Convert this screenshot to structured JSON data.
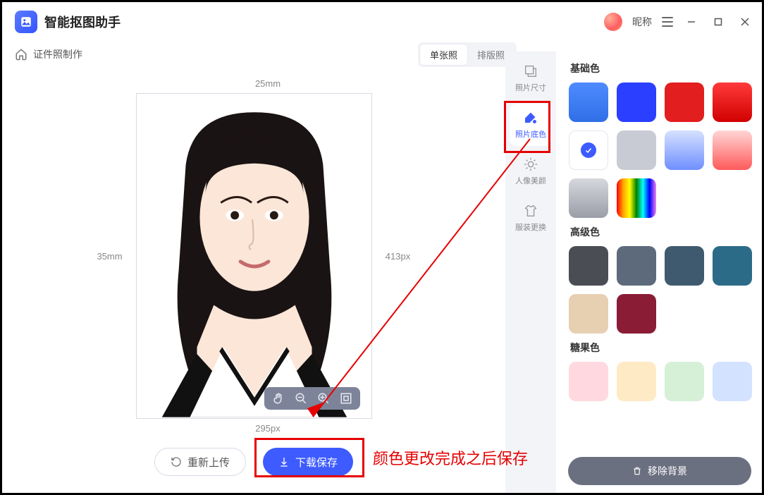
{
  "app": {
    "title": "智能抠图助手",
    "nickname": "昵称"
  },
  "breadcrumb": "证件照制作",
  "tabs": {
    "single": "单张照",
    "layout": "排版照"
  },
  "dimensions": {
    "width_mm": "25mm",
    "height_mm": "35mm",
    "width_px": "295px",
    "height_px": "413px"
  },
  "buttons": {
    "reupload": "重新上传",
    "download": "下载保存",
    "remove_bg": "移除背景"
  },
  "tool_tabs": {
    "size": "照片尺寸",
    "bg": "照片底色",
    "beauty": "人像美颜",
    "dress": "服装更换"
  },
  "color_groups": {
    "basic": {
      "title": "基础色"
    },
    "senior": {
      "title": "高级色"
    },
    "candy": {
      "title": "糖果色"
    }
  },
  "colors": {
    "basic": [
      {
        "css": "linear-gradient(#4f8bff,#2f6fe6)"
      },
      {
        "css": "#2a3fff"
      },
      {
        "css": "#e21e1e"
      },
      {
        "css": "linear-gradient(#ff3a3a,#d10000)"
      },
      {
        "css": "#ffffff",
        "white": true,
        "selected": true
      },
      {
        "css": "#c9cbd4"
      },
      {
        "css": "linear-gradient(#d6e1ff,#6f8fff)"
      },
      {
        "css": "linear-gradient(#ffd6d6,#ff5a5a)"
      },
      {
        "css": "linear-gradient(#d6d8de,#9a9da7)"
      },
      {
        "css": "linear-gradient(90deg,red,orange,yellow,green,cyan,blue,violet)"
      }
    ],
    "senior": [
      {
        "css": "#4a4d54"
      },
      {
        "css": "#5c6a7c"
      },
      {
        "css": "#3f5a6e"
      },
      {
        "css": "#2c6b88"
      },
      {
        "css": "#e7cfb2"
      },
      {
        "css": "#8a1c35"
      }
    ],
    "candy": [
      {
        "css": "#ffd9df"
      },
      {
        "css": "#ffeac6"
      },
      {
        "css": "#d6f0d7"
      },
      {
        "css": "#d3e2ff"
      }
    ]
  },
  "annotation_text": "颜色更改完成之后保存"
}
